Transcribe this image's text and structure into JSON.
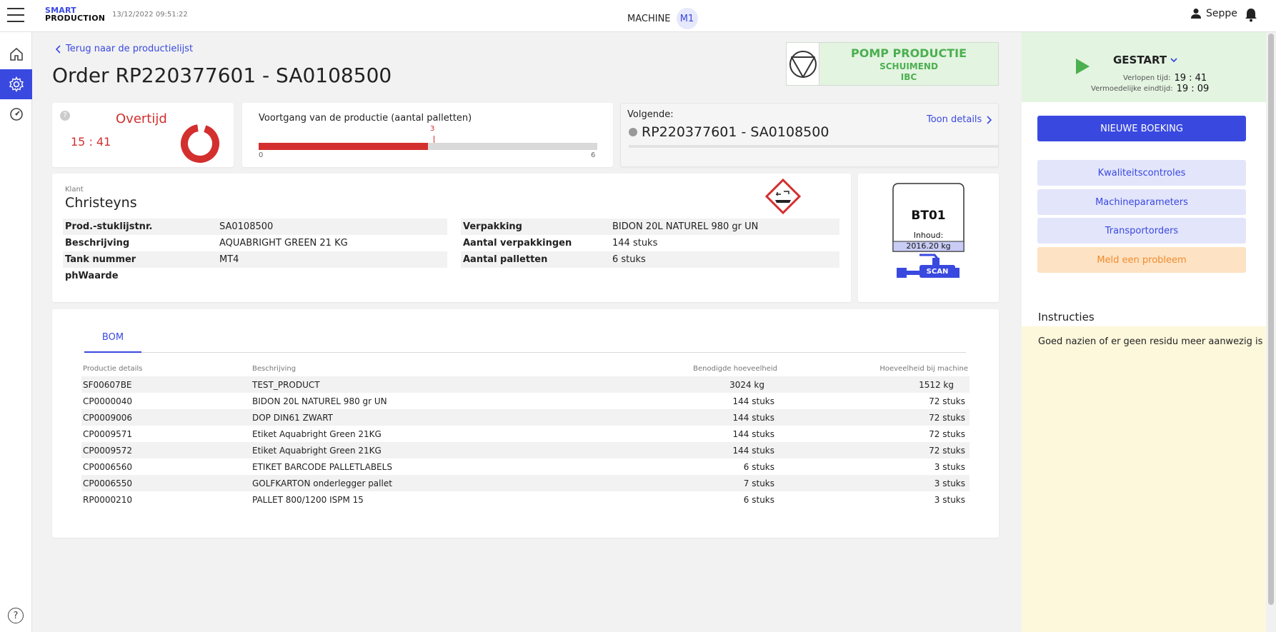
{
  "header": {
    "logo_line1": "SMART",
    "logo_line2": "PRODUCTION",
    "datetime": "13/12/2022 09:51:22",
    "machine_label": "MACHINE",
    "machine_id": "M1",
    "user_name": "Seppe"
  },
  "nav": {
    "items": [
      "home-icon",
      "settings-icon",
      "speedometer-icon"
    ],
    "help": "?"
  },
  "order": {
    "back_link": "Terug naar de productielijst",
    "title": "Order RP220377601 - SA0108500"
  },
  "pomp": {
    "title": "POMP PRODUCTIE",
    "line2": "SCHUIMEND",
    "line3": "IBC"
  },
  "overtime": {
    "help": "?",
    "title": "Overtijd",
    "time": "15 : 41"
  },
  "progress": {
    "title": "Voortgang van de productie (aantal palletten)",
    "current": 3,
    "min": 0,
    "max": 6,
    "current_label": "3",
    "min_label": "0",
    "max_label": "6",
    "fill_color": "#d32f2f"
  },
  "next": {
    "label": "Volgende:",
    "order": "RP220377601 - SA0108500",
    "details_link": "Toon details"
  },
  "customer": {
    "label": "Klant",
    "name": "Christeyns",
    "left_props": [
      {
        "key": "Prod.-stuklijstnr.",
        "value": "SA0108500"
      },
      {
        "key": "Beschrijving",
        "value": "AQUABRIGHT GREEN 21 KG"
      },
      {
        "key": "Tank nummer",
        "value": "MT4"
      },
      {
        "key": "phWaarde",
        "value": ""
      }
    ],
    "right_props": [
      {
        "key": "Verpakking",
        "value": "BIDON 20L NATUREL 980 gr UN"
      },
      {
        "key": "Aantal verpakkingen",
        "value": "144 stuks"
      },
      {
        "key": "Aantal palletten",
        "value": "6 stuks"
      }
    ]
  },
  "tank": {
    "id": "BT01",
    "content_label": "Inhoud:",
    "content_value": "2016.20 kg",
    "scan_label": "SCAN"
  },
  "bom": {
    "tab": "BOM",
    "columns": [
      "Productie details",
      "Beschrijving",
      "Benodigde hoeveelheid",
      "Hoeveelheid bij machine"
    ],
    "rows": [
      [
        "SF00607BE",
        "TEST_PRODUCT",
        "3024 kg",
        "1512 kg"
      ],
      [
        "CP0000040",
        "BIDON 20L NATUREL 980 gr UN",
        "144 stuks",
        "72 stuks"
      ],
      [
        "CP0009006",
        "DOP DIN61 ZWART",
        "144 stuks",
        "72 stuks"
      ],
      [
        "CP0009571",
        "Etiket Aquabright Green 21KG",
        "144 stuks",
        "72 stuks"
      ],
      [
        "CP0009572",
        "Etiket Aquabright Green 21KG",
        "144 stuks",
        "72 stuks"
      ],
      [
        "CP0006560",
        "ETIKET BARCODE PALLETLABELS",
        "6 stuks",
        "3 stuks"
      ],
      [
        "CP0006550",
        "GOLFKARTON onderlegger pallet",
        "7 stuks",
        "3 stuks"
      ],
      [
        "RP0000210",
        "PALLET 800/1200 ISPM 15",
        "6 stuks",
        "3 stuks"
      ]
    ]
  },
  "status": {
    "title": "GESTART",
    "elapsed_label": "Verlopen tijd:",
    "elapsed_value": "19 : 41",
    "eta_label": "Vermoedelijke eindtijd:",
    "eta_value": "19 : 09"
  },
  "actions": {
    "new_booking": "NIEUWE BOEKING",
    "quality": "Kwaliteitscontroles",
    "machine_params": "Machineparameters",
    "transport": "Transportorders",
    "report": "Meld een probleem"
  },
  "instructions": {
    "title": "Instructies",
    "text": "Goed nazien of er geen residu meer aanwezig is"
  }
}
